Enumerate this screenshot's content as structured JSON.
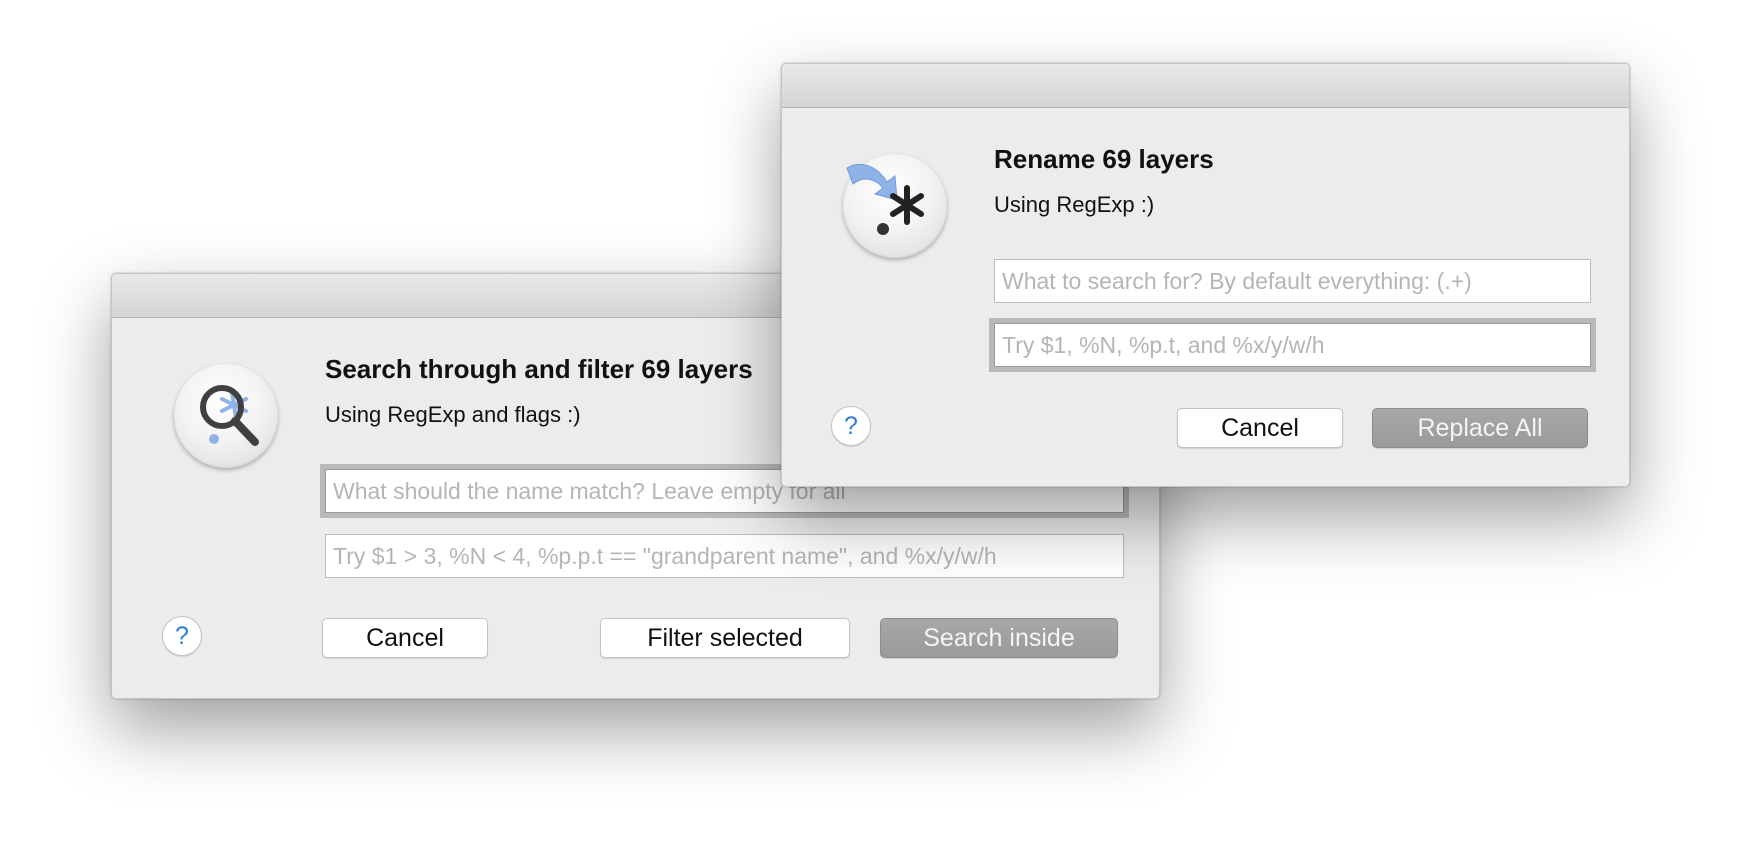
{
  "search_dialog": {
    "title": "Search through and filter 69 layers",
    "subtitle": "Using RegExp and flags :)",
    "icon": "magnifier-regexp-icon",
    "name_match": {
      "value": "",
      "placeholder": "What should the name match? Leave empty for all"
    },
    "condition": {
      "value": "",
      "placeholder": "Try $1 > 3, %N < 4, %p.p.t == \"grandparent name\", and %x/y/w/h"
    },
    "help_label": "?",
    "cancel_label": "Cancel",
    "filter_label": "Filter selected",
    "search_label": "Search inside"
  },
  "rename_dialog": {
    "title": "Rename 69 layers",
    "subtitle": "Using RegExp :)",
    "icon": "rename-regexp-icon",
    "search_for": {
      "value": "",
      "placeholder": "What to search for? By default everything: (.+)"
    },
    "replace_with": {
      "value": "",
      "placeholder": "Try $1, %N, %p.t, and %x/y/w/h"
    },
    "help_label": "?",
    "cancel_label": "Cancel",
    "replace_label": "Replace All"
  },
  "colors": {
    "dialog_background": "#ececec",
    "default_button": "#9f9f9f",
    "help_glyph": "#2f7fd8",
    "icon_accent": "#8fb3e6"
  }
}
